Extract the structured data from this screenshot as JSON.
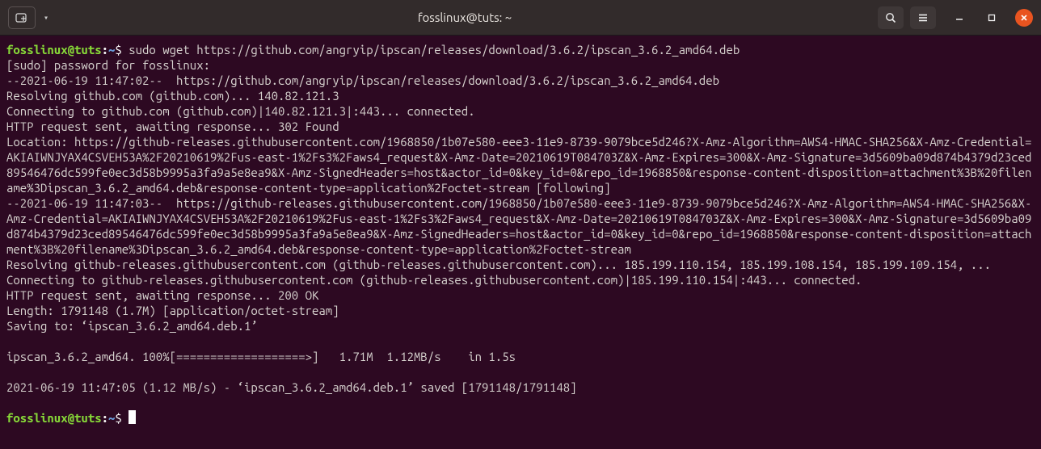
{
  "titlebar": {
    "title": "fosslinux@tuts: ~"
  },
  "prompt": {
    "user_host": "fosslinux@tuts",
    "separator": ":",
    "path": "~",
    "symbol": "$"
  },
  "command": "sudo wget https://github.com/angryip/ipscan/releases/download/3.6.2/ipscan_3.6.2_amd64.deb",
  "output_lines": [
    "[sudo] password for fosslinux:",
    "--2021-06-19 11:47:02--  https://github.com/angryip/ipscan/releases/download/3.6.2/ipscan_3.6.2_amd64.deb",
    "Resolving github.com (github.com)... 140.82.121.3",
    "Connecting to github.com (github.com)|140.82.121.3|:443... connected.",
    "HTTP request sent, awaiting response... 302 Found",
    "Location: https://github-releases.githubusercontent.com/1968850/1b07e580-eee3-11e9-8739-9079bce5d246?X-Amz-Algorithm=AWS4-HMAC-SHA256&X-Amz-Credential=AKIAIWNJYAX4CSVEH53A%2F20210619%2Fus-east-1%2Fs3%2Faws4_request&X-Amz-Date=20210619T084703Z&X-Amz-Expires=300&X-Amz-Signature=3d5609ba09d874b4379d23ced89546476dc599fe0ec3d58b9995a3fa9a5e8ea9&X-Amz-SignedHeaders=host&actor_id=0&key_id=0&repo_id=1968850&response-content-disposition=attachment%3B%20filename%3Dipscan_3.6.2_amd64.deb&response-content-type=application%2Foctet-stream [following]",
    "--2021-06-19 11:47:03--  https://github-releases.githubusercontent.com/1968850/1b07e580-eee3-11e9-8739-9079bce5d246?X-Amz-Algorithm=AWS4-HMAC-SHA256&X-Amz-Credential=AKIAIWNJYAX4CSVEH53A%2F20210619%2Fus-east-1%2Fs3%2Faws4_request&X-Amz-Date=20210619T084703Z&X-Amz-Expires=300&X-Amz-Signature=3d5609ba09d874b4379d23ced89546476dc599fe0ec3d58b9995a3fa9a5e8ea9&X-Amz-SignedHeaders=host&actor_id=0&key_id=0&repo_id=1968850&response-content-disposition=attachment%3B%20filename%3Dipscan_3.6.2_amd64.deb&response-content-type=application%2Foctet-stream",
    "Resolving github-releases.githubusercontent.com (github-releases.githubusercontent.com)... 185.199.110.154, 185.199.108.154, 185.199.109.154, ...",
    "Connecting to github-releases.githubusercontent.com (github-releases.githubusercontent.com)|185.199.110.154|:443... connected.",
    "HTTP request sent, awaiting response... 200 OK",
    "Length: 1791148 (1.7M) [application/octet-stream]",
    "Saving to: ‘ipscan_3.6.2_amd64.deb.1’",
    "",
    "ipscan_3.6.2_amd64. 100%[===================>]   1.71M  1.12MB/s    in 1.5s",
    "",
    "2021-06-19 11:47:05 (1.12 MB/s) - ‘ipscan_3.6.2_amd64.deb.1’ saved [1791148/1791148]",
    ""
  ]
}
